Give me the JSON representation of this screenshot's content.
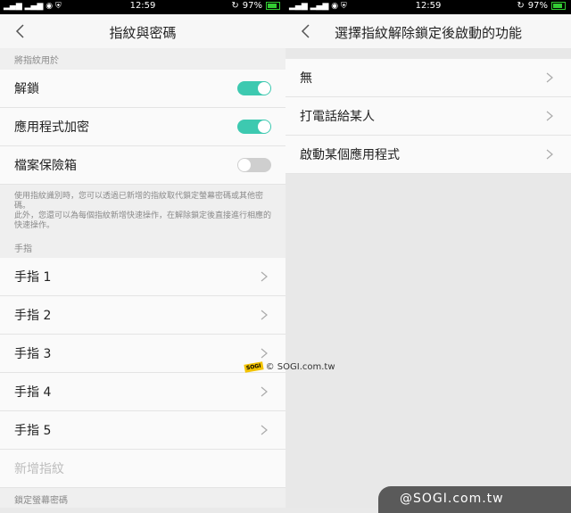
{
  "status": {
    "time": "12:59",
    "battery": "97%"
  },
  "left": {
    "title": "指紋與密碼",
    "section_use": "將指紋用於",
    "toggles": [
      {
        "label": "解鎖",
        "on": true
      },
      {
        "label": "應用程式加密",
        "on": true
      },
      {
        "label": "檔案保險箱",
        "on": false
      }
    ],
    "desc_1": "使用指紋識別時，您可以透過已新增的指紋取代鎖定螢幕密碼或其他密碼。",
    "desc_2": "此外，您還可以為每個指紋新增快速操作，在解除鎖定後直接進行相應的快速操作。",
    "section_fingers": "手指",
    "fingers": [
      "手指 1",
      "手指 2",
      "手指 3",
      "手指 4",
      "手指 5"
    ],
    "add_fingerprint": "新增指紋",
    "section_lock": "鎖定螢幕密碼"
  },
  "right": {
    "title": "選擇指紋解除鎖定後啟動的功能",
    "options": [
      "無",
      "打電話給某人",
      "啟動某個應用程式"
    ]
  },
  "watermark": {
    "logo": "SOGI",
    "small": "© SOGI.com.tw",
    "large": "@SOGI.com.tw"
  }
}
